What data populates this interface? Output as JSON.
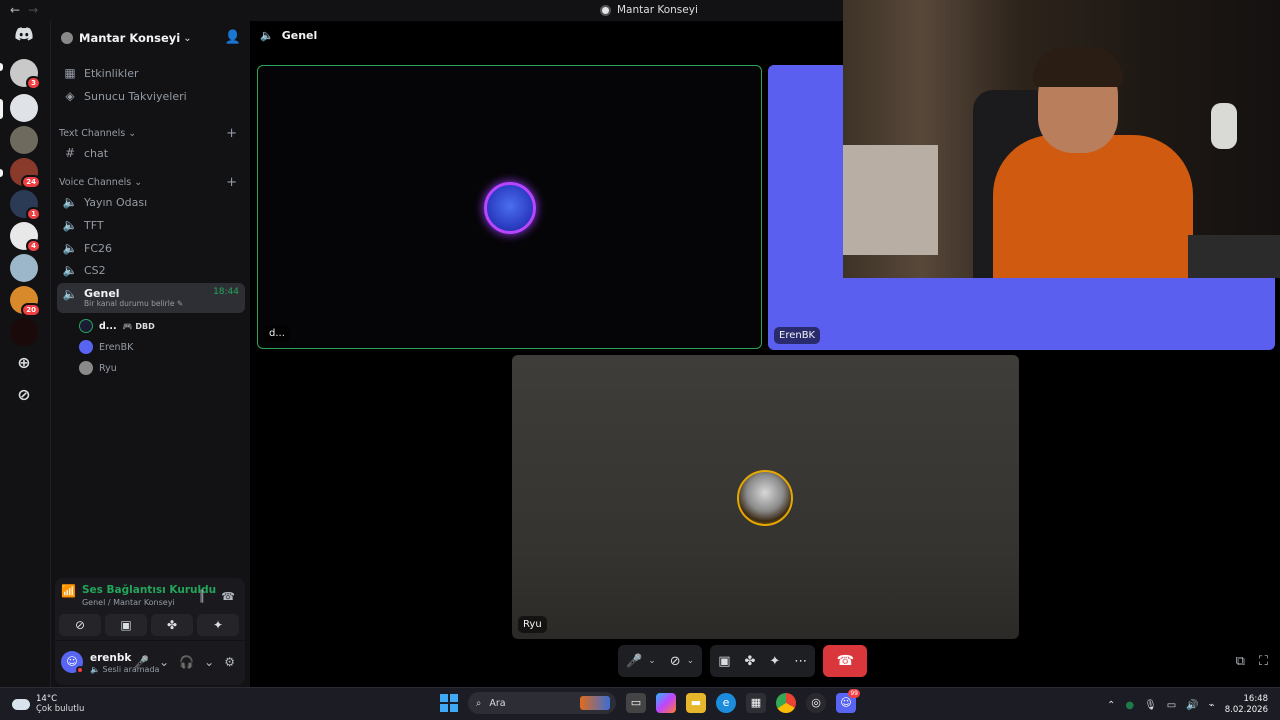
{
  "window": {
    "title": "Mantar Konseyi"
  },
  "server": {
    "name": "Mantar Konseyi",
    "guilds": [
      {
        "name": "guild-1",
        "badge": "3",
        "color": "#c9c9c9"
      },
      {
        "name": "guild-2",
        "badge": "",
        "color": "#dfe3e8"
      },
      {
        "name": "guild-3",
        "badge": "",
        "color": "#6f6a5e"
      },
      {
        "name": "guild-4",
        "badge": "24",
        "color": "#8a3a2a"
      },
      {
        "name": "guild-5",
        "badge": "1",
        "color": "#2b3a55"
      },
      {
        "name": "guild-6",
        "badge": "4",
        "color": "#e8e8e8"
      },
      {
        "name": "guild-7",
        "badge": "",
        "color": "#9bb7c9"
      },
      {
        "name": "guild-8",
        "badge": "20",
        "color": "#d8892a"
      },
      {
        "name": "guild-9",
        "badge": "",
        "color": "#1b0a0a"
      }
    ]
  },
  "sidebar": {
    "events_label": "Etkinlikler",
    "boosts_label": "Sunucu Takviyeleri",
    "text_category": "Text Channels",
    "text_channels": [
      "chat"
    ],
    "voice_category": "Voice Channels",
    "voice_channels": [
      "Yayın Odası",
      "TFT",
      "FC26",
      "CS2"
    ],
    "active_channel": {
      "name": "Genel",
      "time": "18:44",
      "status_hint": "Bir kanal durumu belirle"
    },
    "voice_users": [
      {
        "name": "d...",
        "tag": "DBD"
      },
      {
        "name": "ErenBK",
        "tag": ""
      },
      {
        "name": "Ryu",
        "tag": ""
      }
    ]
  },
  "voice_panel": {
    "title": "Ses Bağlantısı Kuruldu",
    "subtitle": "Genel / Mantar Konseyi"
  },
  "user_panel": {
    "username": "erenbk",
    "status": "Sesli aramada"
  },
  "main": {
    "channel_name": "Genel",
    "tiles": [
      {
        "label": "d..."
      },
      {
        "label": "ErenBK"
      },
      {
        "label": "Ryu"
      }
    ]
  },
  "taskbar": {
    "temperature": "14°C",
    "weather": "Çok bulutlu",
    "search_placeholder": "Ara",
    "time": "16:48",
    "date": "8.02.2026",
    "discord_badge": "99"
  },
  "colors": {
    "accent": "#5865f2",
    "connected": "#23a55a",
    "danger": "#da373c",
    "speaking_border": "#2fa35a"
  }
}
